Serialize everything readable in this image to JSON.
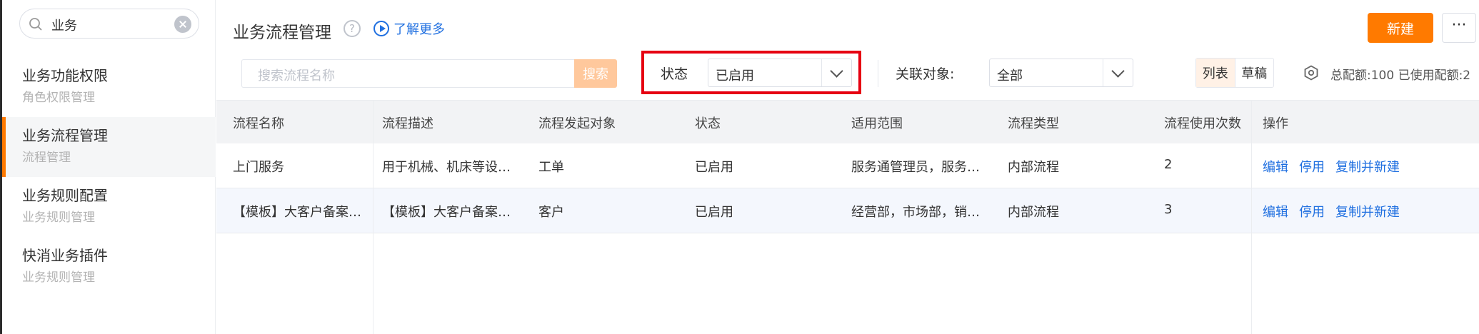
{
  "sidebar": {
    "search_value": "业务",
    "items": [
      {
        "title": "业务功能权限",
        "sub": "角色权限管理"
      },
      {
        "title": "业务流程管理",
        "sub": "流程管理"
      },
      {
        "title": "业务规则配置",
        "sub": "业务规则管理"
      },
      {
        "title": "快消业务插件",
        "sub": "业务规则管理"
      }
    ]
  },
  "header": {
    "title": "业务流程管理",
    "help": "?",
    "learn_more": "了解更多",
    "new_label": "新建",
    "more_label": "···"
  },
  "filters": {
    "search_placeholder": "搜索流程名称",
    "search_button": "搜索",
    "status_label": "状态",
    "status_value": "已启用",
    "related_label": "关联对象:",
    "related_value": "全部",
    "view_list": "列表",
    "view_draft": "草稿",
    "quota_text": "总配额:100 已使用配额:2"
  },
  "table": {
    "columns": [
      "流程名称",
      "流程描述",
      "流程发起对象",
      "状态",
      "适用范围",
      "流程类型",
      "流程使用次数",
      "操作"
    ],
    "rows": [
      {
        "name": "上门服务",
        "desc": "用于机械、机床等设备上门维修服务",
        "target": "工单",
        "status": "已启用",
        "scope": "服务通管理员，服务人员",
        "type": "内部流程",
        "count": "2",
        "actions": [
          "编辑",
          "停用",
          "复制并新建"
        ]
      },
      {
        "name": "【模板】大客户备案流程",
        "desc": "【模板】大客户备案流程说明",
        "target": "客户",
        "status": "已启用",
        "scope": "经营部，市场部，销售部",
        "type": "内部流程",
        "count": "3",
        "actions": [
          "编辑",
          "停用",
          "复制并新建"
        ]
      }
    ]
  },
  "colors": {
    "accent": "#ff7a00",
    "link": "#1f6fe0",
    "highlight": "#e60012"
  }
}
